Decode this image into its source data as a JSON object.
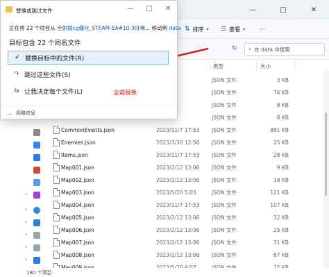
{
  "dialog": {
    "title": "替换或跳过文件",
    "line1_prefix": "正在将 22 个项目从",
    "line1_source": "全剧情cg僵化_STEAM-EA#10-30[稀...",
    "line1_mid": "移动到",
    "line1_dest": "data",
    "heading": "目标包含 22 个同名文件",
    "options": [
      {
        "label": "替换目标中的文件(R)",
        "icon": "checkmark-icon",
        "icon_char": "✔",
        "icon_color": "#107c10"
      },
      {
        "label": "跳过这些文件(S)",
        "icon": "skip-icon",
        "icon_char": "↷",
        "icon_color": "#0b5cad"
      },
      {
        "label": "让我决定每个文件(L)",
        "icon": "decide-icon",
        "icon_char": "⇆",
        "icon_color": "#107c10"
      }
    ],
    "annotation": "全選替换",
    "details_label": "简略信息",
    "minimize": "—",
    "maximize": "□",
    "close": "✕"
  },
  "explorer": {
    "window_controls": [
      "—",
      "□",
      "✕"
    ],
    "toolbar": {
      "sort_label": "排序",
      "view_label": "查看",
      "more": "···"
    },
    "search_placeholder": "在 data 中搜索",
    "columns": {
      "type": "类型",
      "size": "大小"
    },
    "status": "180 个项目",
    "files": [
      {
        "name": "",
        "date": "9:07",
        "type": "JSON 文件",
        "size": "3 KB"
      },
      {
        "name": "",
        "date": "9:07",
        "type": "JSON 文件",
        "size": "76 KB"
      },
      {
        "name": "",
        "date": "13:06",
        "type": "JSON 文件",
        "size": "8 KB"
      },
      {
        "name": "",
        "date": "9:07",
        "type": "JSON 文件",
        "size": "8 KB"
      },
      {
        "name": "CommonEvents.json",
        "date": "2023/11/7 17:53",
        "type": "JSON 文件",
        "size": "881 KB"
      },
      {
        "name": "Enemies.json",
        "date": "2023/7/30 12:56",
        "type": "JSON 文件",
        "size": "25 KB"
      },
      {
        "name": "Items.json",
        "date": "2023/11/7 17:53",
        "type": "JSON 文件",
        "size": "28 KB"
      },
      {
        "name": "Map001.json",
        "date": "2023/2/12 13:06",
        "type": "JSON 文件",
        "size": "9 KB"
      },
      {
        "name": "Map002.json",
        "date": "2023/2/12 13:06",
        "type": "JSON 文件",
        "size": "18 KB"
      },
      {
        "name": "Map003.json",
        "date": "2023/5/20 5:03",
        "type": "JSON 文件",
        "size": "121 KB"
      },
      {
        "name": "Map004.json",
        "date": "2023/11/7 17:53",
        "type": "JSON 文件",
        "size": "107 KB"
      },
      {
        "name": "Map005.json",
        "date": "2023/2/12 13:06",
        "type": "JSON 文件",
        "size": "32 KB"
      },
      {
        "name": "Map006.json",
        "date": "2023/2/12 13:06",
        "type": "JSON 文件",
        "size": "25 KB"
      },
      {
        "name": "Map007.json",
        "date": "2023/2/12 13:06",
        "type": "JSON 文件",
        "size": "31 KB"
      },
      {
        "name": "Map008.json",
        "date": "2023/2/12 13:06",
        "type": "JSON 文件",
        "size": "67 KB"
      },
      {
        "name": "Map009.json",
        "date": "2023/5/20 9:07",
        "type": "JSON 文件",
        "size": "15 KB"
      }
    ]
  }
}
